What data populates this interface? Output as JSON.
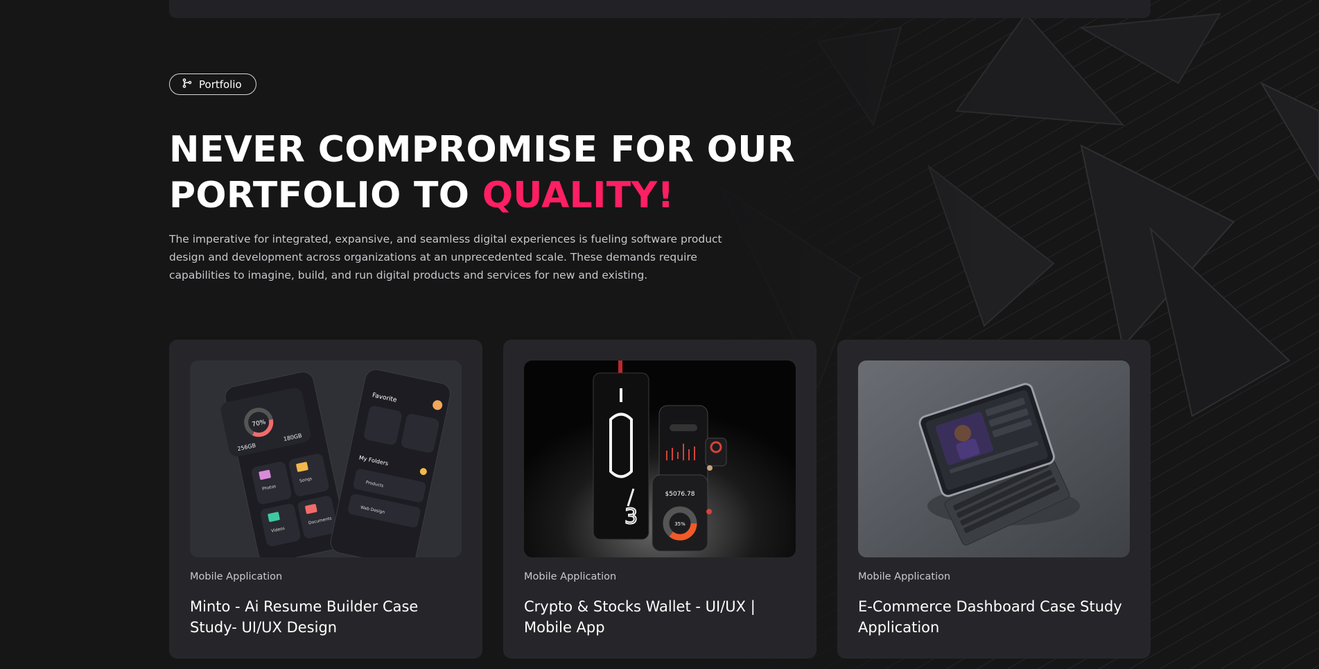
{
  "section": {
    "badge_label": "Portfolio",
    "badge_icon": "branch-icon",
    "headline_line1": "NEVER COMPROMISE FOR OUR",
    "headline_line2_prefix": "PORTFOLIO TO ",
    "headline_accent": "QUALITY!",
    "accent_color": "#ff1f63",
    "description": "The imperative for integrated, expansive, and seamless digital experiences is fueling software product design and development across organizations at an unprecedented scale. These demands require capabilities to imagine, build, and run digital products and services for new and existing."
  },
  "cards": [
    {
      "category": "Mobile Application",
      "title": "Minto - Ai Resume Builder Case Study- UI/UX Design",
      "image": "phone-mockup-dark-ui",
      "mockup_text": {
        "percent": "70%",
        "storage_a": "256GB",
        "storage_b": "180GB",
        "favorite": "Favorite",
        "photos": "Photos",
        "videos": "Videos",
        "songs": "Songs",
        "documents": "Documents",
        "my_folders": "My Folders",
        "products": "Products",
        "web_design": "Web Design"
      }
    },
    {
      "category": "Mobile Application",
      "title": "Crypto & Stocks Wallet - UI/UX | Mobile App",
      "image": "crypto-wallet-phones",
      "mockup_text": {
        "amount": "$5076.78",
        "donut": "35%"
      }
    },
    {
      "category": "Mobile Application",
      "title": "E-Commerce Dashboard Case Study Application",
      "image": "tablet-keyboard-mockup"
    }
  ]
}
